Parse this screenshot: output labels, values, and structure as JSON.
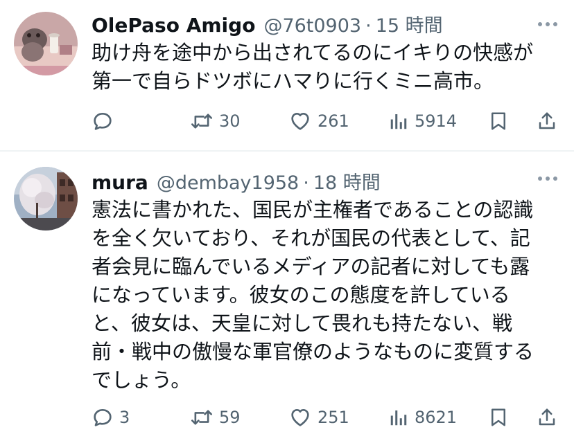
{
  "tweets": [
    {
      "name": "OlePaso Amigo",
      "handle": "@76t0903",
      "separator": "·",
      "time": "15 時間",
      "text_lines": [
        "助け舟を途中から出されてるのにイキりの快感が",
        "第一で自らドツボにハマりに行くミニ高市。"
      ],
      "replies": "",
      "reposts": "30",
      "likes": "261",
      "views": "5914"
    },
    {
      "name": "mura",
      "handle": "@dembay1958",
      "separator": "·",
      "time": "18 時間",
      "text_lines": [
        "憲法に書かれた、国民が主権者であることの認識",
        "を全く欠いており、それが国民の代表として、記",
        "者会見に臨んでいるメディアの記者に対しても露",
        "になっています。彼女のこの態度を許している",
        "と、彼女は、天皇に対して畏れも持たない、戦",
        "前・戦中の傲慢な軍官僚のようなものに変質する",
        "でしょう。"
      ],
      "replies": "3",
      "reposts": "59",
      "likes": "251",
      "views": "8621"
    }
  ],
  "icons": {
    "reply": "reply-icon",
    "repost": "repost-icon",
    "like": "heart-icon",
    "views": "views-icon",
    "bookmark": "bookmark-icon",
    "share": "share-icon",
    "more": "more-icon"
  },
  "colors": {
    "text": "#0f1419",
    "secondary": "#536471",
    "divider": "#eff3f4"
  }
}
